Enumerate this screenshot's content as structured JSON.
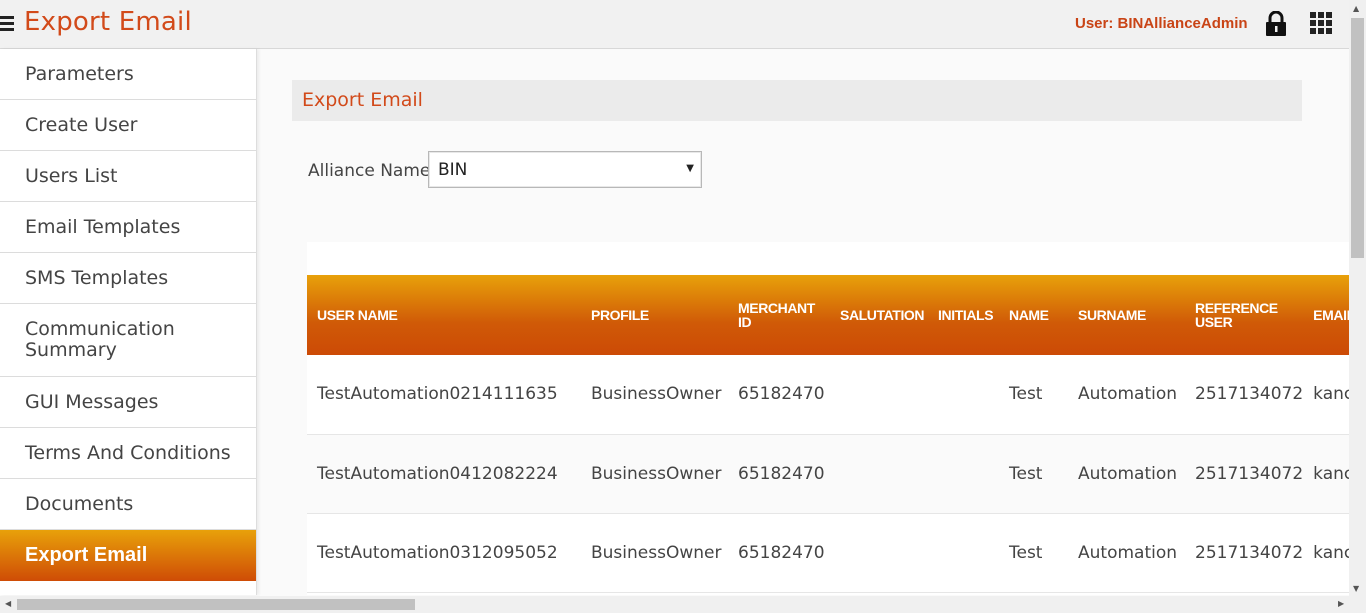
{
  "header": {
    "title": "Export Email",
    "user_label": "User: BINAllianceAdmin",
    "icons": [
      "menu-icon",
      "lock-icon",
      "apps-grid-icon"
    ],
    "accent_color": "#d24a1a"
  },
  "sidebar": {
    "items": [
      {
        "label": "Parameters"
      },
      {
        "label": "Create User"
      },
      {
        "label": "Users List"
      },
      {
        "label": "Email Templates"
      },
      {
        "label": "SMS Templates"
      },
      {
        "label": "Communication Summary"
      },
      {
        "label": "GUI Messages"
      },
      {
        "label": "Terms And Conditions"
      },
      {
        "label": "Documents"
      },
      {
        "label": "Export Email",
        "active": true
      }
    ]
  },
  "main": {
    "section_title": "Export Email",
    "alliance_label": "Alliance Name",
    "alliance_value": "BIN"
  },
  "table": {
    "headers": [
      "USER NAME",
      "PROFILE",
      "MERCHANT ID",
      "SALUTATION",
      "INITIALS",
      "NAME",
      "SURNAME",
      "REFERENCE USER",
      "EMAIL"
    ],
    "rows": [
      [
        "TestAutomation0214111635",
        "BusinessOwner",
        "65182470",
        "",
        "",
        "Test",
        "Automation",
        "2517134072",
        "kanc"
      ],
      [
        "TestAutomation0412082224",
        "BusinessOwner",
        "65182470",
        "",
        "",
        "Test",
        "Automation",
        "2517134072",
        "kanc"
      ],
      [
        "TestAutomation0312095052",
        "BusinessOwner",
        "65182470",
        "",
        "",
        "Test",
        "Automation",
        "2517134072",
        "kanc"
      ]
    ]
  }
}
